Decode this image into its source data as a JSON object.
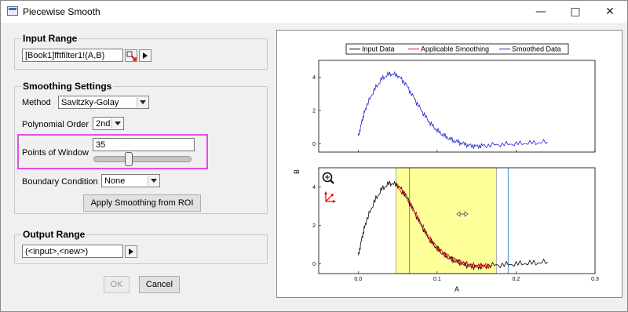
{
  "window": {
    "title": "Piecewise Smooth"
  },
  "input_range": {
    "label": "Input Range",
    "value": "[Book1]fftfilter1!(A,B)"
  },
  "smoothing": {
    "label": "Smoothing Settings",
    "method_label": "Method",
    "method_value": "Savitzky-Golay",
    "poly_label": "Polynomial Order",
    "poly_value": "2nd",
    "points_label": "Points of Window",
    "points_value": "35",
    "slider_fraction": 0.35,
    "boundary_label": "Boundary Condition",
    "boundary_value": "None",
    "apply_button": "Apply Smoothing from ROI"
  },
  "output_range": {
    "label": "Output Range",
    "value": "(<input>,<new>)"
  },
  "buttons": {
    "ok": "OK",
    "cancel": "Cancel"
  },
  "colors": {
    "input": "#000000",
    "applicable": "#e8001c",
    "smoothed": "#1f1fcf",
    "roi_fill": "#ffff99",
    "roi_border": "#4a90d9",
    "highlight": "#e24ee3"
  },
  "chart_data": [
    {
      "type": "line",
      "legend": [
        "Input Data",
        "Applicable Smoothing",
        "Smoothed Data"
      ],
      "legend_placement": "top",
      "ylim": [
        -0.5,
        5
      ],
      "yticks": [
        "0",
        "2",
        "4"
      ],
      "xlim": [
        -0.05,
        0.3
      ],
      "series": [
        {
          "name": "Smoothed Data",
          "x": [
            0.0,
            0.005,
            0.01,
            0.02,
            0.03,
            0.04,
            0.05,
            0.06,
            0.07,
            0.08,
            0.09,
            0.1,
            0.11,
            0.12,
            0.13,
            0.14,
            0.15,
            0.16,
            0.18,
            0.2,
            0.22,
            0.24
          ],
          "y": [
            0.4,
            1.4,
            2.2,
            3.2,
            3.9,
            4.2,
            4.1,
            3.6,
            2.8,
            2.0,
            1.3,
            0.8,
            0.45,
            0.2,
            0.05,
            -0.1,
            -0.15,
            -0.1,
            -0.05,
            0.0,
            0.05,
            0.1
          ]
        }
      ]
    },
    {
      "type": "line",
      "xlabel": "A",
      "ylabel": "B",
      "xlim": [
        -0.05,
        0.3
      ],
      "ylim": [
        -0.5,
        5
      ],
      "xticks": [
        "0.0",
        "0.1",
        "0.2",
        "0.3"
      ],
      "yticks": [
        "0",
        "2",
        "4"
      ],
      "roi": [
        0.048,
        0.175
      ],
      "roi_inner_lines": [
        0.065,
        0.19
      ],
      "series": [
        {
          "name": "Input Data",
          "x": [
            0.0,
            0.005,
            0.01,
            0.02,
            0.03,
            0.04,
            0.05,
            0.06,
            0.07,
            0.08,
            0.09,
            0.1,
            0.11,
            0.12,
            0.13,
            0.14,
            0.15,
            0.16,
            0.18,
            0.2,
            0.22,
            0.24
          ],
          "y": [
            0.4,
            1.4,
            2.2,
            3.2,
            3.9,
            4.2,
            4.1,
            3.6,
            2.8,
            2.0,
            1.3,
            0.8,
            0.45,
            0.2,
            0.05,
            -0.1,
            -0.15,
            -0.1,
            -0.05,
            0.0,
            0.05,
            0.1
          ]
        },
        {
          "name": "Applicable Smoothing",
          "x": [
            0.05,
            0.06,
            0.07,
            0.08,
            0.09,
            0.1,
            0.11,
            0.12,
            0.13,
            0.14,
            0.15,
            0.16,
            0.17
          ],
          "y": [
            4.0,
            3.55,
            2.8,
            2.05,
            1.35,
            0.85,
            0.5,
            0.25,
            0.08,
            -0.05,
            -0.1,
            -0.1,
            -0.08
          ]
        }
      ]
    }
  ]
}
